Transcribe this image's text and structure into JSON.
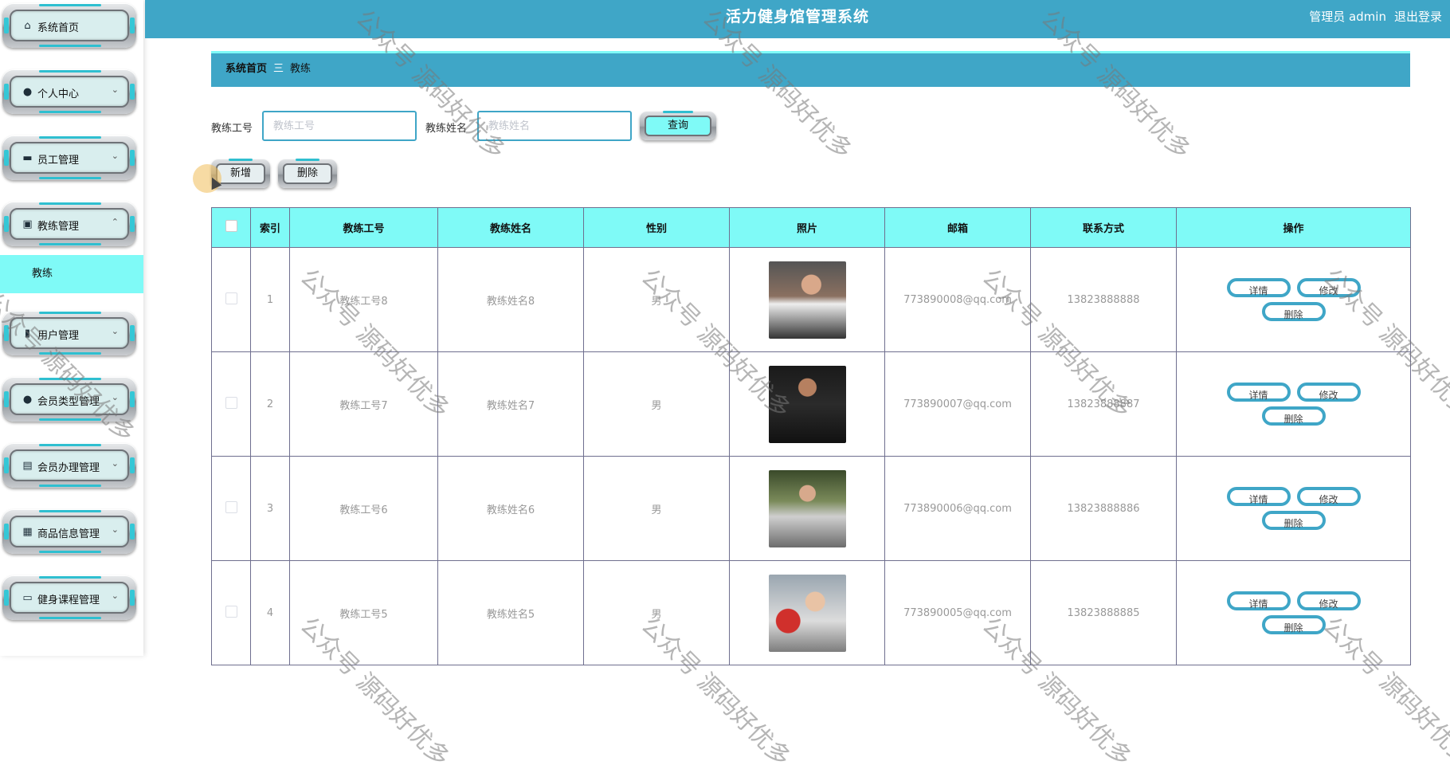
{
  "header": {
    "title": "活力健身馆管理系统",
    "user_label": "管理员 admin",
    "logout_label": "退出登录"
  },
  "sidebar": {
    "items": [
      {
        "label": "系统首页",
        "icon": "home-icon",
        "glyph": "⌂",
        "chevron": ""
      },
      {
        "label": "个人中心",
        "icon": "user-icon",
        "glyph": "●",
        "chevron": "⌄"
      },
      {
        "label": "员工管理",
        "icon": "box-icon",
        "glyph": "▬",
        "chevron": "⌄"
      },
      {
        "label": "教练管理",
        "icon": "briefcase-icon",
        "glyph": "▣",
        "chevron": "⌃"
      },
      {
        "label": "用户管理",
        "icon": "bar-chart-icon",
        "glyph": "▮",
        "chevron": "⌄"
      },
      {
        "label": "会员类型管理",
        "icon": "user-icon",
        "glyph": "●",
        "chevron": "⌄"
      },
      {
        "label": "会员办理管理",
        "icon": "clipboard-icon",
        "glyph": "▤",
        "chevron": "⌄"
      },
      {
        "label": "商品信息管理",
        "icon": "grid-icon",
        "glyph": "▦",
        "chevron": "⌄"
      },
      {
        "label": "健身课程管理",
        "icon": "monitor-icon",
        "glyph": "▭",
        "chevron": "⌄"
      }
    ],
    "submenu_active": "教练"
  },
  "breadcrumb": {
    "home": "系统首页",
    "separator": "三",
    "current": "教练"
  },
  "search": {
    "field1_label": "教练工号",
    "field1_placeholder": "教练工号",
    "field2_label": "教练姓名",
    "field2_placeholder": "教练姓名",
    "query_label": "查询"
  },
  "actions": {
    "add_label": "新增",
    "delete_label": "删除"
  },
  "table": {
    "columns": [
      "索引",
      "教练工号",
      "教练姓名",
      "性别",
      "照片",
      "邮箱",
      "联系方式",
      "操作"
    ],
    "op_labels": {
      "detail": "详情",
      "edit": "修改",
      "delete": "删除"
    },
    "rows": [
      {
        "index": "1",
        "code": "教练工号8",
        "name": "教练姓名8",
        "gender": "男",
        "email": "773890008@qq.com",
        "phone": "13823888888"
      },
      {
        "index": "2",
        "code": "教练工号7",
        "name": "教练姓名7",
        "gender": "男",
        "email": "773890007@qq.com",
        "phone": "13823888887"
      },
      {
        "index": "3",
        "code": "教练工号6",
        "name": "教练姓名6",
        "gender": "男",
        "email": "773890006@qq.com",
        "phone": "13823888886"
      },
      {
        "index": "4",
        "code": "教练工号5",
        "name": "教练姓名5",
        "gender": "男",
        "email": "773890005@qq.com",
        "phone": "13823888885"
      }
    ]
  },
  "watermark": "公众号 源码好优多",
  "colors": {
    "header": "#3fa6c7",
    "accent_cyan": "#7ffaf7",
    "menu_inner": "#d9eeee"
  }
}
